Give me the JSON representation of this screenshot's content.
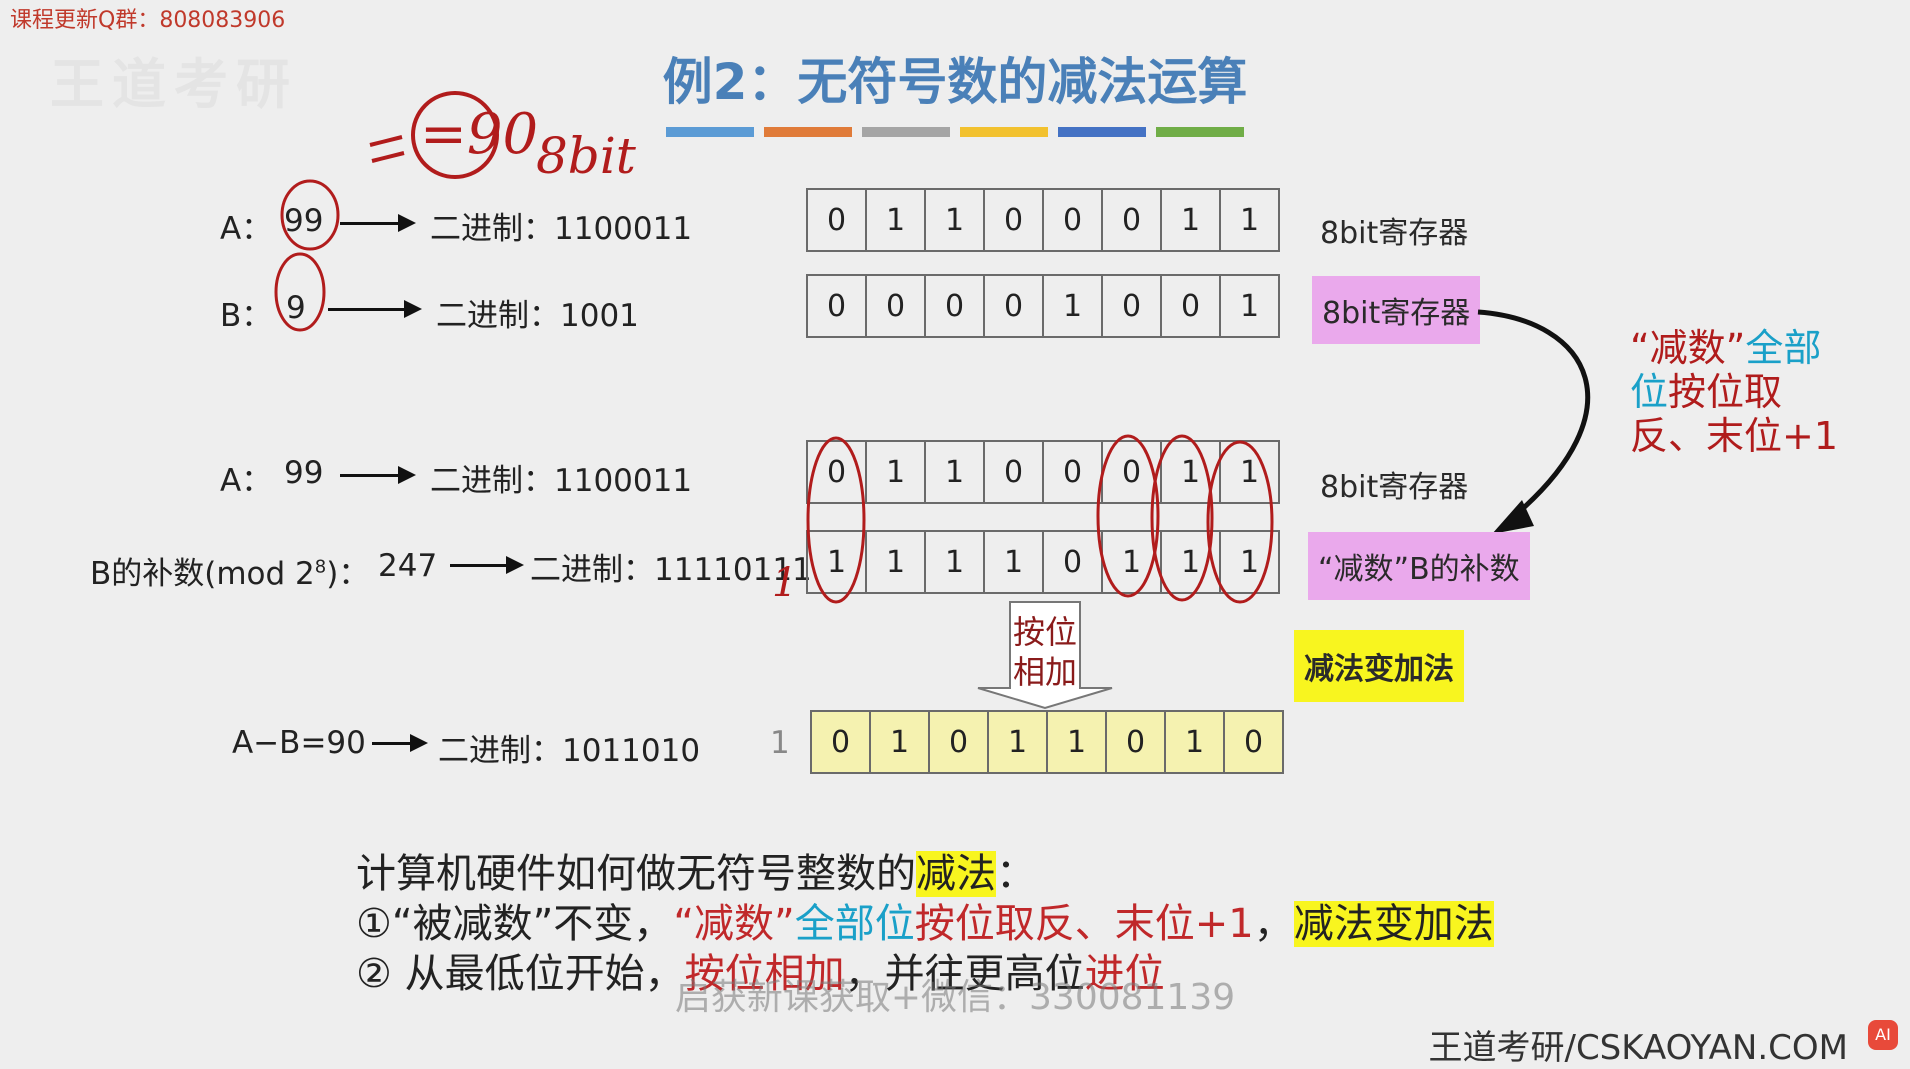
{
  "top_watermark": "课程更新Q群：808083906",
  "ghost_logo": "王道考研",
  "title": "例2：无符号数的减法运算",
  "title_bar_colors": [
    "#5b9bd5",
    "#e07b39",
    "#a5a5a5",
    "#f2c12e",
    "#4472c4",
    "#70ad47"
  ],
  "handwriting": {
    "result": "=90",
    "bits": "8bit",
    "carry": "1"
  },
  "rows": {
    "a1": {
      "label": "A：",
      "value": "99",
      "bin": "二进制：1100011",
      "bits": [
        "0",
        "1",
        "1",
        "0",
        "0",
        "0",
        "1",
        "1"
      ],
      "tag": "8bit寄存器"
    },
    "b1": {
      "label": "B：",
      "value": "9",
      "bin": "二进制：1001",
      "bits": [
        "0",
        "0",
        "0",
        "0",
        "1",
        "0",
        "0",
        "1"
      ],
      "tag": "8bit寄存器"
    },
    "a2": {
      "label": "A：",
      "value": "99",
      "bin": "二进制：1100011",
      "bits": [
        "0",
        "1",
        "1",
        "0",
        "0",
        "0",
        "1",
        "1"
      ],
      "tag": "8bit寄存器"
    },
    "b2": {
      "label_prefix": "B的补数(mod 2",
      "label_sup": "8",
      "label_suffix": ")：",
      "value": "247",
      "bin": "二进制：11110111",
      "bits": [
        "1",
        "1",
        "1",
        "1",
        "0",
        "1",
        "1",
        "1"
      ],
      "tag": "“减数”B的补数"
    },
    "result": {
      "label": "A−B=90",
      "bin": "二进制：1011010",
      "carry": "1",
      "bits": [
        "0",
        "1",
        "0",
        "1",
        "1",
        "0",
        "1",
        "0"
      ]
    }
  },
  "op_arrow_label": [
    "按位",
    "相加"
  ],
  "sub_to_add_tag": "减法变加法",
  "side_note": {
    "q1": "“减数”",
    "q2": "全部",
    "q3": "位",
    "q4": "按位取",
    "q5": "反、末位+1"
  },
  "summary": {
    "line1_a": "计算机硬件如何做无符号整数的",
    "line1_b": "减法",
    "line1_c": "：",
    "line2_a": "①“被减数”不变，",
    "line2_b": "“减数”",
    "line2_c": "全部位",
    "line2_d": "按位取反、",
    "line2_e": "末位+1",
    "line2_f": "，",
    "line2_g": "减法变加法",
    "line3_a": "② 从最低位开始，",
    "line3_b": "按位相加",
    "line3_c": "，并往更高位",
    "line3_d": "进位"
  },
  "subtitle_overlay": "启获新课获取+微信：330081139",
  "footer": "王道考研/CSKAOYAN.COM"
}
